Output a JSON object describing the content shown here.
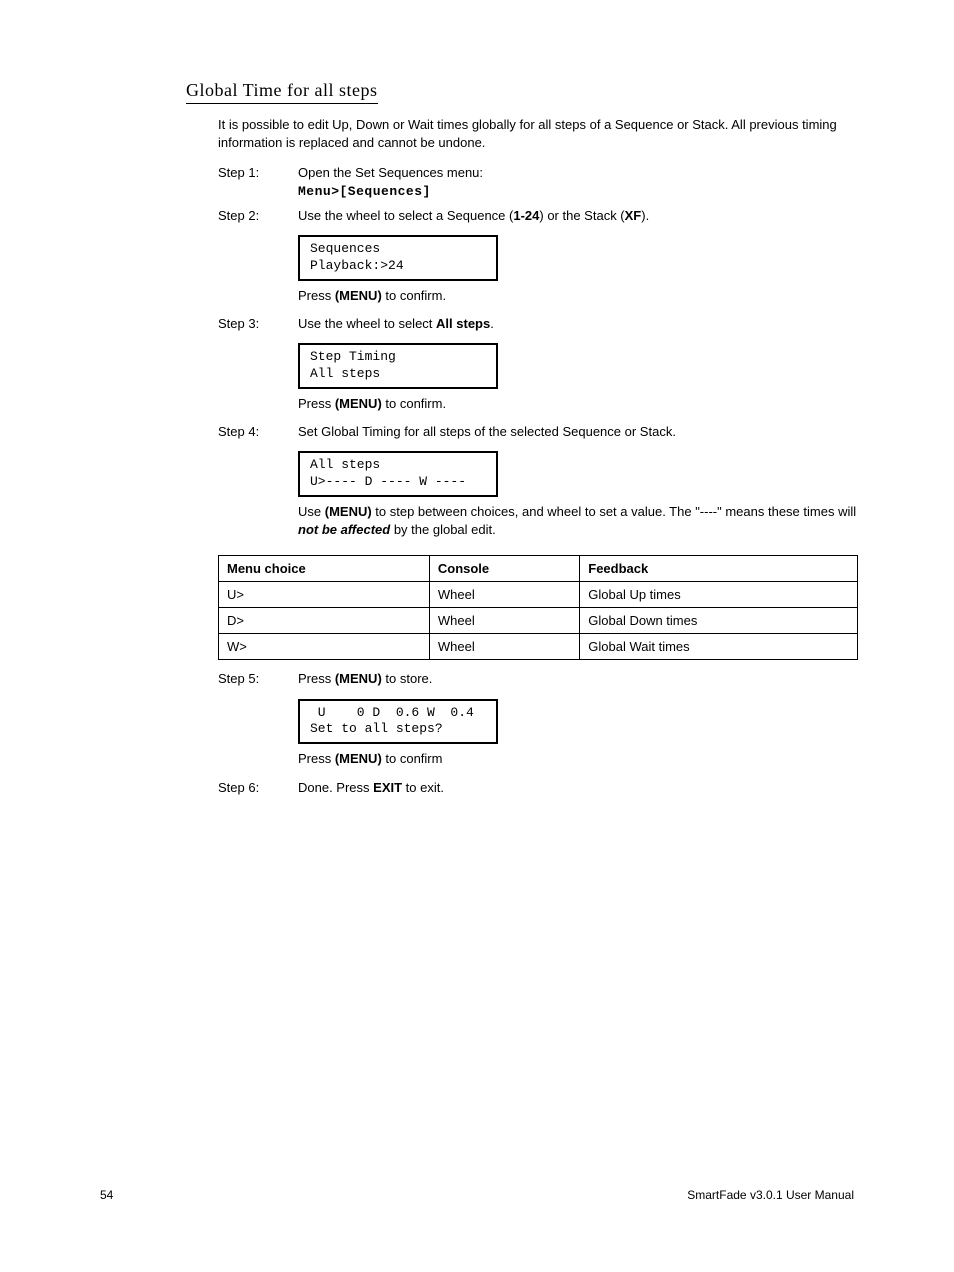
{
  "title": "Global Time for all steps",
  "intro": "It is possible to edit Up, Down or Wait times globally for all steps of a Sequence or Stack. All previous timing information is replaced and cannot be undone.",
  "steps": {
    "s1": {
      "label": "Step 1:",
      "text": "Open the Set Sequences menu:",
      "menu": "Menu>[Sequences]"
    },
    "s2": {
      "label": "Step 2:",
      "pre": "Use the wheel to select a Sequence (",
      "b1": "1-24",
      "mid": ") or the Stack (",
      "b2": "XF",
      "post": ").",
      "lcd1": "Sequences",
      "lcd2": "Playback:>24",
      "confirm_pre": "Press ",
      "confirm_b": "(MENU)",
      "confirm_post": " to confirm."
    },
    "s3": {
      "label": "Step 3:",
      "pre": "Use the wheel to select ",
      "b1": "All steps",
      "post": ".",
      "lcd1": "Step Timing",
      "lcd2": "All steps",
      "confirm_pre": "Press ",
      "confirm_b": "(MENU)",
      "confirm_post": " to confirm."
    },
    "s4": {
      "label": "Step 4:",
      "text": "Set Global Timing for all steps of the selected Sequence or Stack.",
      "lcd1": "All steps",
      "lcd2": " U>---- D ---- W ----",
      "note_pre": "Use ",
      "note_b": "(MENU)",
      "note_mid": " to step between choices, and wheel to set a value. The \"----\" means these times will ",
      "note_bi": "not be affected",
      "note_post": " by the global edit."
    },
    "s5": {
      "label": "Step 5:",
      "pre": "Press ",
      "b1": "(MENU)",
      "post": " to store.",
      "lcd1": " U    0 D  0.6 W  0.4",
      "lcd2": "Set to all steps?",
      "confirm_pre": "Press ",
      "confirm_b": "(MENU)",
      "confirm_post": " to confirm"
    },
    "s6": {
      "label": "Step 6:",
      "pre": "Done. Press ",
      "b1": "EXIT",
      "post": " to exit."
    }
  },
  "table": {
    "headers": [
      "Menu choice",
      "Console",
      "Feedback"
    ],
    "rows": [
      [
        "U>",
        "Wheel",
        "Global Up times"
      ],
      [
        "D>",
        "Wheel",
        "Global Down times"
      ],
      [
        "W>",
        "Wheel",
        "Global Wait times"
      ]
    ]
  },
  "footer": {
    "page": "54",
    "manual": "SmartFade v3.0.1 User Manual"
  }
}
